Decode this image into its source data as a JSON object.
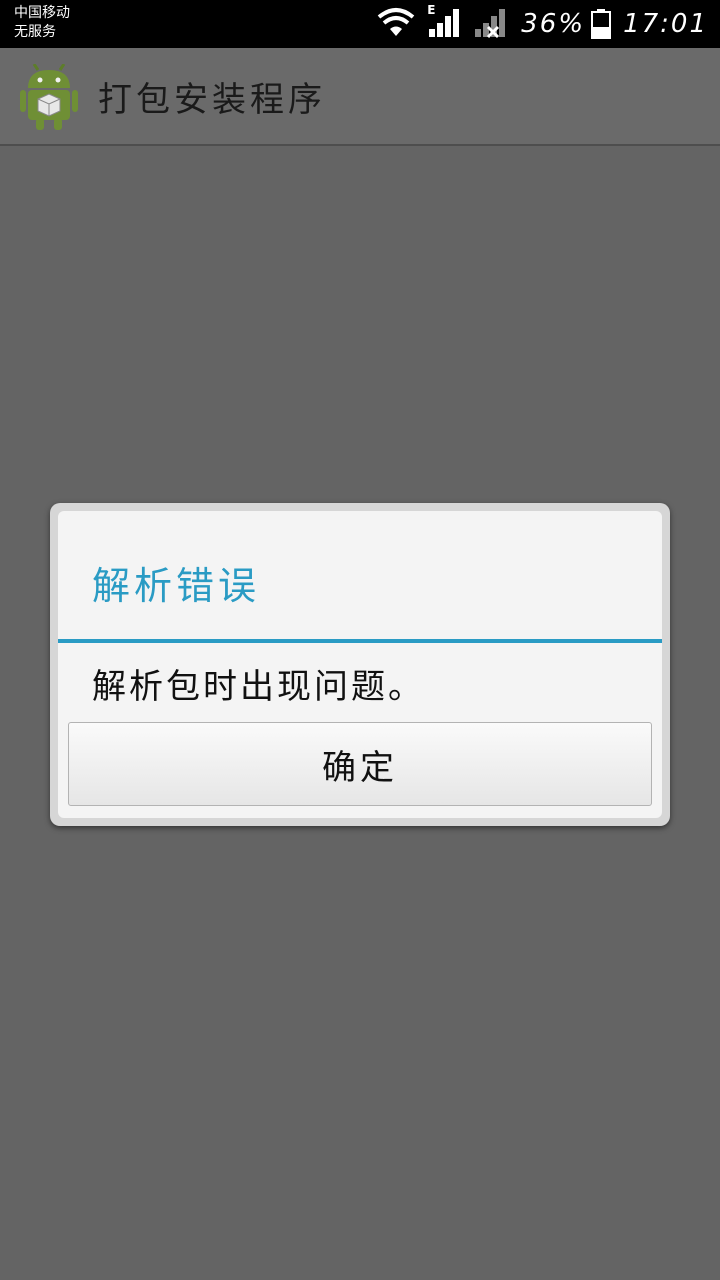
{
  "status_bar": {
    "carrier_line1": "中国移动",
    "carrier_line2": "无服务",
    "network_type": "E",
    "battery_percent": "36%",
    "time": "17:01",
    "icons": [
      "wifi-icon",
      "signal-icon",
      "no-signal-icon",
      "battery-icon"
    ]
  },
  "action_bar": {
    "title": "打包安装程序",
    "icon": "android-package-installer-icon"
  },
  "dialog": {
    "title": "解析错误",
    "message": "解析包时出现问题。",
    "ok_label": "确定",
    "accent_color": "#2a9bc4"
  }
}
